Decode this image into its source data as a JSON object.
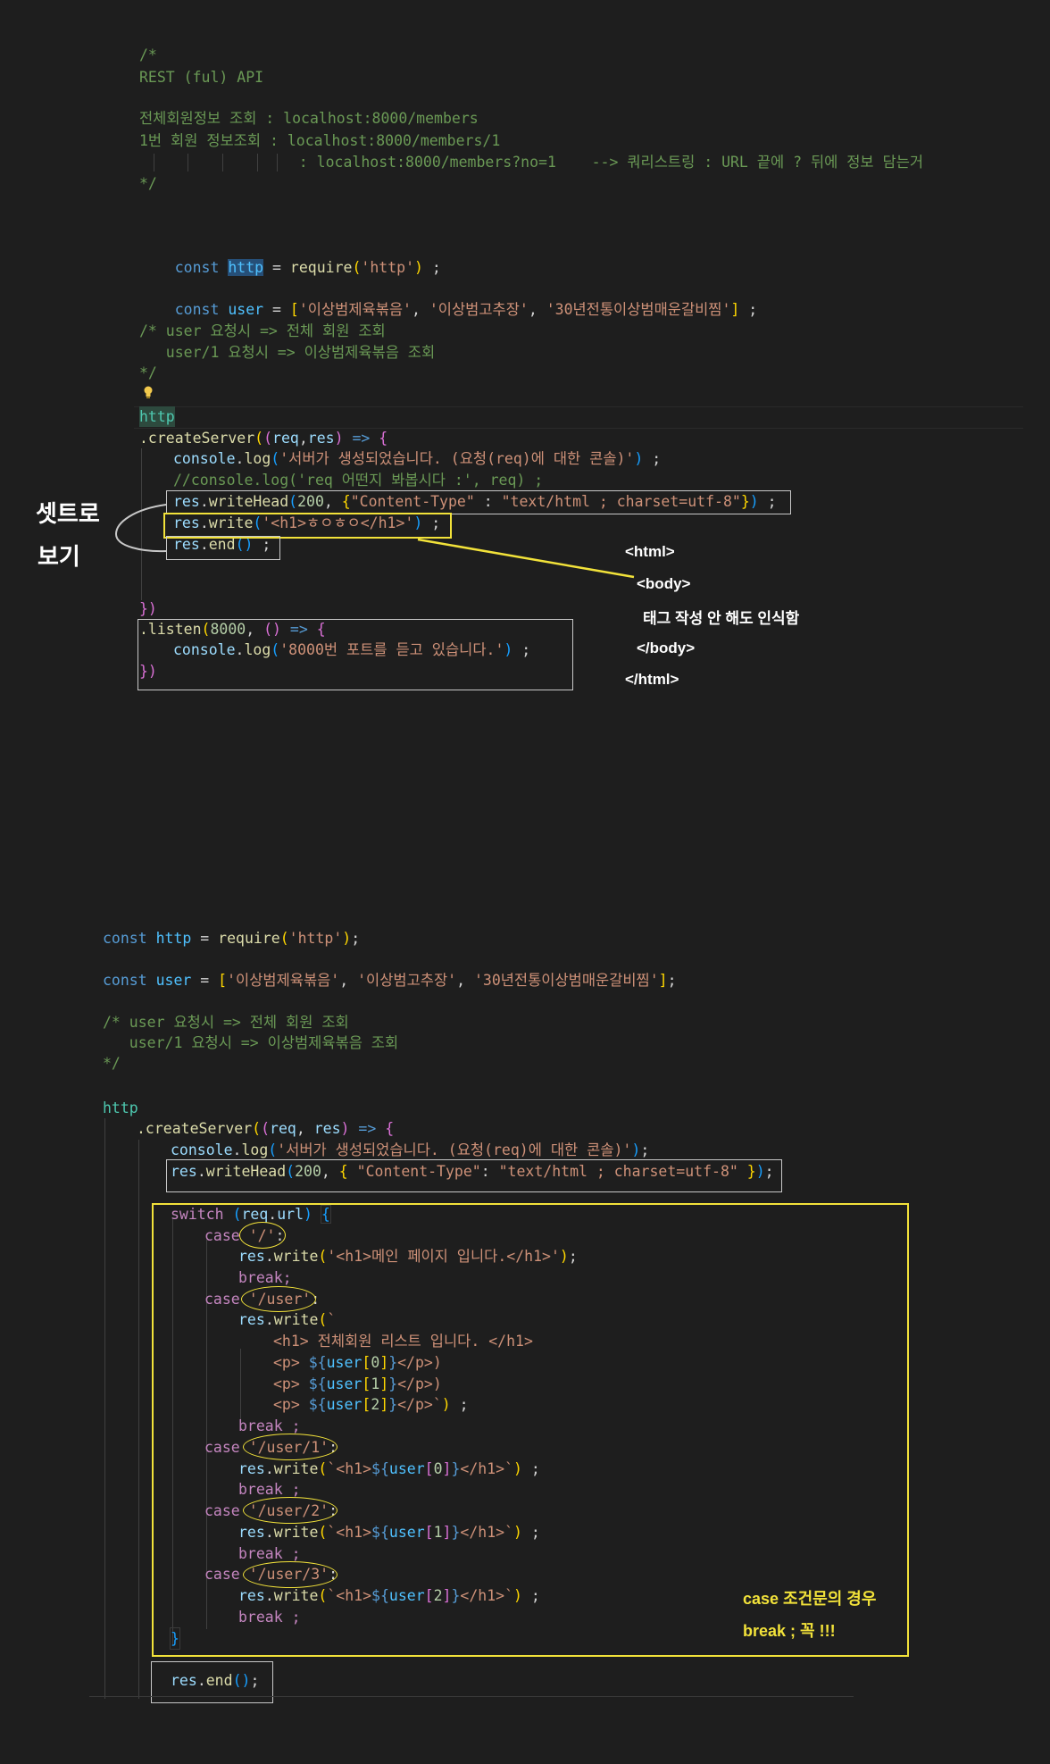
{
  "top_code": {
    "comment_block": [
      "/*",
      "REST (ful) API",
      "",
      "전체회원정보 조회 : localhost:8000/members",
      "1번 회원 정보조회 : localhost:8000/members/1",
      "                  : localhost:8000/members?no=1    --> 쿼리스트링 : URL 끝에 ? 뒤에 정보 담는거",
      "*/"
    ],
    "require_line": {
      "kw": "const",
      "name": "http",
      "eq": " = ",
      "fn": "require",
      "arg": "'http'",
      "end": " ;"
    },
    "user_line": {
      "kw": "const",
      "name": "user",
      "items": [
        "'이상범제육볶음'",
        "'이상범고추장'",
        "'30년전통이상범매운갈비찜'"
      ],
      "end": " ;"
    },
    "comment2": [
      "/* user 요청시 => 전체 회원 조회",
      "   user/1 요청시 => 이상범제육볶음 조회",
      "*/"
    ],
    "http_word": "http",
    "create_server": ".createServer((req,res) => {",
    "log1": "console.log('서버가 생성되었습니다. (요청(req)에 대한 콘솔)') ;",
    "log2": "//console.log('req 어떤지 봐봅시다 :', req) ;",
    "write_head": "res.writeHead(200, {\"Content-Type\" : \"text/html ; charset=utf-8\"}) ;",
    "write": "res.write('<h1>ㅎㅇㅎㅇ</h1>') ;",
    "end": "res.end() ;",
    "close": "})",
    "listen": ".listen(8000, () => {",
    "listen_log": "console.log('8000번 포트를 듣고 있습니다.') ;",
    "listen_close": "})"
  },
  "annotations": {
    "set_label_line1": "셋트로",
    "set_label_line2": "보기",
    "html_note": [
      "<html>",
      "<body>",
      "태그 작성 안 해도 인식함",
      "</body>",
      "</html>"
    ],
    "case_note_line1": "case 조건문의 경우",
    "case_note_line2": "break ; 꼭 !!!"
  },
  "bottom_code": {
    "require_line": "const http = require('http');",
    "user_line": "const user = ['이상범제육볶음', '이상범고추장', '30년전통이상범매운갈비찜'];",
    "comment": [
      "/* user 요청시 => 전체 회원 조회",
      "   user/1 요청시 => 이상범제육볶음 조회",
      "*/"
    ],
    "http_word": "http",
    "create_server": ".createServer((req, res) => {",
    "log": "console.log('서버가 생성되었습니다. (요청(req)에 대한 콘솔)');",
    "write_head": "res.writeHead(200, { \"Content-Type\": \"text/html ; charset=utf-8\" });",
    "switch": "switch (req.url) {",
    "cases": [
      {
        "case": "'/'",
        "body": [
          "res.write('<h1>메인 페이지 입니다.</h1>');",
          "break;"
        ]
      },
      {
        "case": "'/user'",
        "body": [
          "res.write(`",
          "    <h1> 전체회원 리스트 입니다. </h1>",
          "    <p> ${user[0]}</p>)",
          "    <p> ${user[1]}</p>)",
          "    <p> ${user[2]}</p>`) ;",
          "break ;"
        ]
      },
      {
        "case": "'/user/1'",
        "body": [
          "res.write(`<h1>${user[0]}</h1>`) ;",
          "break ;"
        ]
      },
      {
        "case": "'/user/2'",
        "body": [
          "res.write(`<h1>${user[1]}</h1>`) ;",
          "break ;"
        ]
      },
      {
        "case": "'/user/3'",
        "body": [
          "res.write(`<h1>${user[2]}</h1>`) ;",
          "break ;"
        ]
      }
    ],
    "switch_close": "}",
    "end": "res.end();"
  },
  "colors": {
    "background": "#1e1e1e",
    "comment": "#6a9955",
    "keyword": "#569cd6",
    "string": "#ce9178",
    "highlight_yellow": "#f2e23a",
    "box_white": "#c8c8c8"
  }
}
